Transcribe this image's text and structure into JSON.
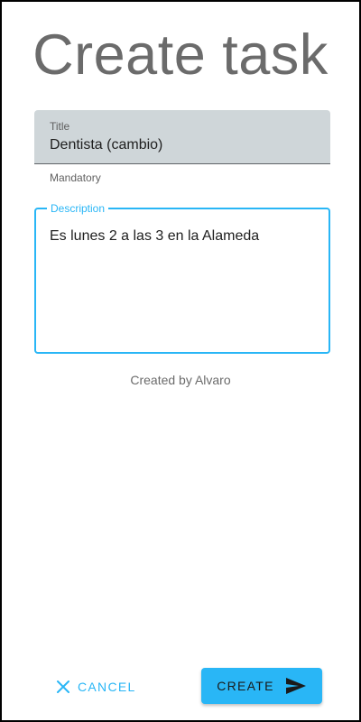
{
  "page": {
    "title": "Create task"
  },
  "title_field": {
    "label": "Title",
    "value": "Dentista (cambio)",
    "helper": "Mandatory"
  },
  "description_field": {
    "label": "Description",
    "value": "Es lunes 2 a las 3 en la Alameda"
  },
  "meta": {
    "created_by": "Created by Alvaro"
  },
  "actions": {
    "cancel_label": "CANCEL",
    "cancel_icon": "close-icon",
    "create_label": "CREATE",
    "create_icon": "send-icon"
  },
  "colors": {
    "accent": "#29b6f6",
    "title_field_bg": "#cfd6d9",
    "heading": "#6b6b6b"
  }
}
